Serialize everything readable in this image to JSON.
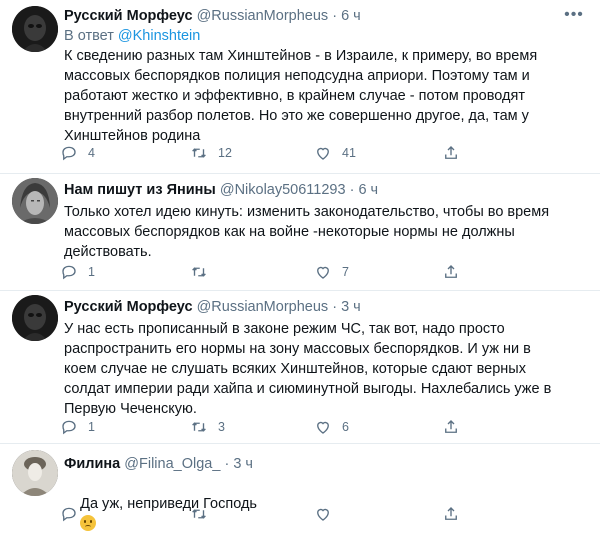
{
  "tweets": [
    {
      "name": "Русский Морфеус",
      "handle": "@RussianMorpheus",
      "time": "6 ч",
      "reply_prefix": "В ответ",
      "reply_mention": "@Khinshtein",
      "text": "К сведению разных там Хинштейнов - в Израиле, к примеру, во время\nмассовых беспорядков полиция неподсудна априори. Поэтому там и\nработают жестко и эффективно, в крайнем случае - потом проводят\nвнутренний разбор полетов. Но это же совершенно другое, да, там у\nХинштейнов родина",
      "reply_count": "4",
      "retweet_count": "12",
      "like_count": "41"
    },
    {
      "name": "Нам пишут из Янины",
      "handle": "@Nikolay50611293",
      "time": "6 ч",
      "text": "Только хотел идею кинуть: изменить законодательство, чтобы во время\nмассовых беспорядков как на войне -некоторые нормы не должны\nдействовать.",
      "reply_count": "1",
      "retweet_count": "",
      "like_count": "7"
    },
    {
      "name": "Русский Морфеус",
      "handle": "@RussianMorpheus",
      "time": "3 ч",
      "text": "У нас есть прописанный в законе режим ЧС, так вот, надо просто\nраспространить его нормы на зону массовых беспорядков. И уж ни в\nкоем случае не слушать всяких Хинштейнов, которые сдают верных\nсолдат империи ради хайпа и сиюминутной выгоды. Нахлебались уже в\nПервую Чеченскую.",
      "reply_count": "1",
      "retweet_count": "3",
      "like_count": "6"
    },
    {
      "name": "Филина",
      "handle": "@Filina_Olga_",
      "time": "3 ч",
      "text": "Да уж, неприведи Господь",
      "emoji": "worried-face-icon"
    }
  ],
  "separator": "·",
  "colors": {
    "text": "#0f1419",
    "muted": "#5b7083",
    "link": "#1b95e0",
    "divider": "#e6ecf0"
  }
}
